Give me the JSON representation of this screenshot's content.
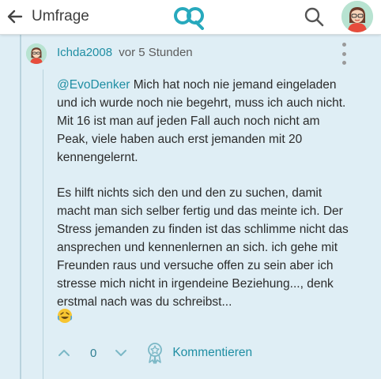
{
  "header": {
    "back_label": "Umfrage",
    "back_icon": "arrow-left-icon",
    "logo_icon": "app-logo-icon",
    "search_icon": "search-icon",
    "avatar_icon": "user-avatar-icon"
  },
  "comment": {
    "username": "Ichda2008",
    "timestamp": "vor 5 Stunden",
    "mention": "@EvoDenker",
    "paragraph1_rest": " Mich hat noch nie jemand eingeladen und ich wurde noch nie begehrt, muss ich auch nicht. Mit 16 ist man auf jeden Fall auch noch nicht am Peak, viele haben auch erst jemanden mit 20 kennengelernt.",
    "paragraph2": "Es hilft nichts sich den und den zu suchen, damit macht man sich selber fertig und das meinte ich. Der Stress jemanden zu finden ist das schlimme nicht das ansprechen und kennenlernen an sich. ich gehe mit Freunden raus und versuche offen zu sein aber ich stresse mich nicht in irgendeine Beziehung..., denk erstmal nach was du schreibst...",
    "emoji_icon": "rofl-emoji-icon"
  },
  "actions": {
    "vote_count": "0",
    "comment_label": "Kommentieren"
  },
  "colors": {
    "background": "#dfeef5",
    "accent": "#1f8ea3",
    "avatar_bg": "#b8e3d1"
  }
}
